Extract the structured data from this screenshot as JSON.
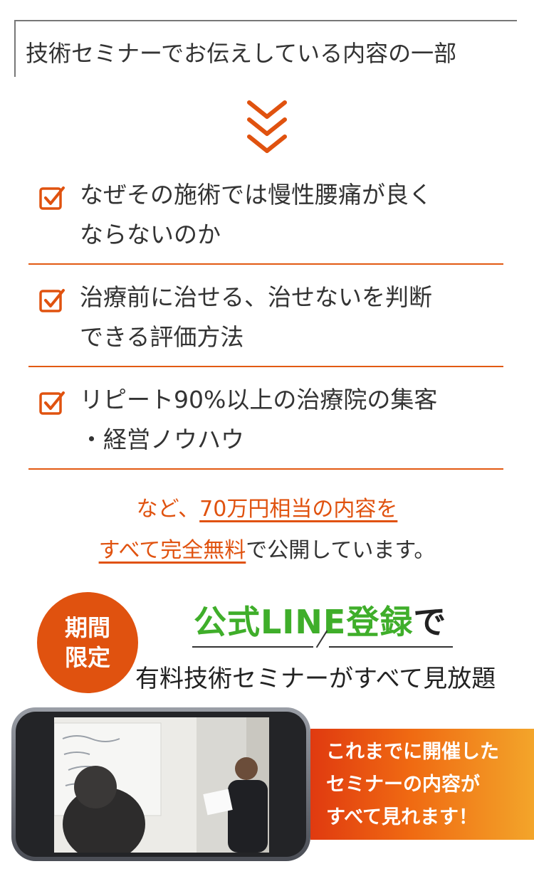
{
  "heading": "技術セミナーでお伝えしている内容の一部",
  "items": [
    {
      "text": "なぜその施術では慢性腰痛が良く\nならないのか"
    },
    {
      "text": "治療前に治せる、治せないを判断\nできる評価方法"
    },
    {
      "text": "リピート90%以上の治療院の集客\n・経営ノウハウ"
    }
  ],
  "note": {
    "line1_prefix": "など、",
    "line1_link": "70万円相当の内容を",
    "line2_link": "すべて完全無料",
    "line2_suffix": "で公開しています。"
  },
  "badge": {
    "line1": "期間",
    "line2": "限定"
  },
  "cta": {
    "title_green": "公式LINE登録",
    "title_black": "で",
    "subtitle": "有料技術セミナーがすべて見放題"
  },
  "panel": {
    "text": "これまでに開催した\nセミナーの内容が\nすべて見れます！"
  },
  "colors": {
    "accent": "#e0520f",
    "line_green": "#3fae2a"
  }
}
